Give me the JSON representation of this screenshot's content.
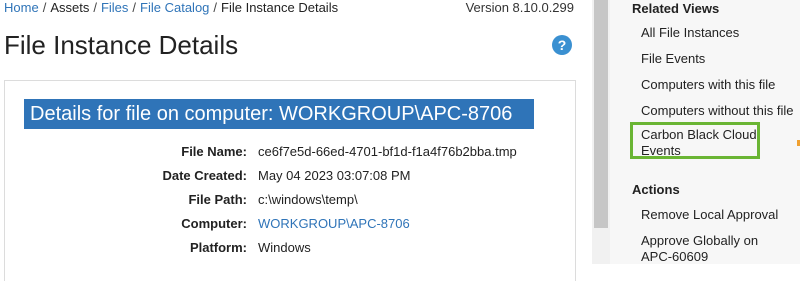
{
  "breadcrumb": {
    "items": [
      {
        "label": "Home",
        "link": true
      },
      {
        "label": "Assets",
        "link": false
      },
      {
        "label": "Files",
        "link": true
      },
      {
        "label": "File Catalog",
        "link": true
      },
      {
        "label": "File Instance Details",
        "link": false
      }
    ],
    "separator": "/"
  },
  "version": "Version 8.10.0.299",
  "page_title": "File Instance Details",
  "help_label": "?",
  "details": {
    "header": "Details for file on computer: WORKGROUP\\APC-8706",
    "fields": [
      {
        "label": "File Name:",
        "value": "ce6f7e5d-66ed-4701-bf1d-f1a4f76b2bba.tmp",
        "link": false
      },
      {
        "label": "Date Created:",
        "value": "May 04 2023 03:07:08 PM",
        "link": false
      },
      {
        "label": "File Path:",
        "value": "c:\\windows\\temp\\",
        "link": false
      },
      {
        "label": "Computer:",
        "value": "WORKGROUP\\APC-8706",
        "link": true
      },
      {
        "label": "Platform:",
        "value": "Windows",
        "link": false
      }
    ]
  },
  "sidebar": {
    "related_heading": "Related Views",
    "related_items": [
      "All File Instances",
      "File Events",
      "Computers with this file",
      "Computers without this file",
      "Carbon Black Cloud Events"
    ],
    "actions_heading": "Actions",
    "action_items": [
      "Remove Local Approval",
      "Approve Globally on APC-60609"
    ]
  },
  "colors": {
    "link": "#2f74b8",
    "header_bar": "#2f74b8",
    "help_button": "#3a90d1",
    "highlight_border": "#6ab534"
  }
}
